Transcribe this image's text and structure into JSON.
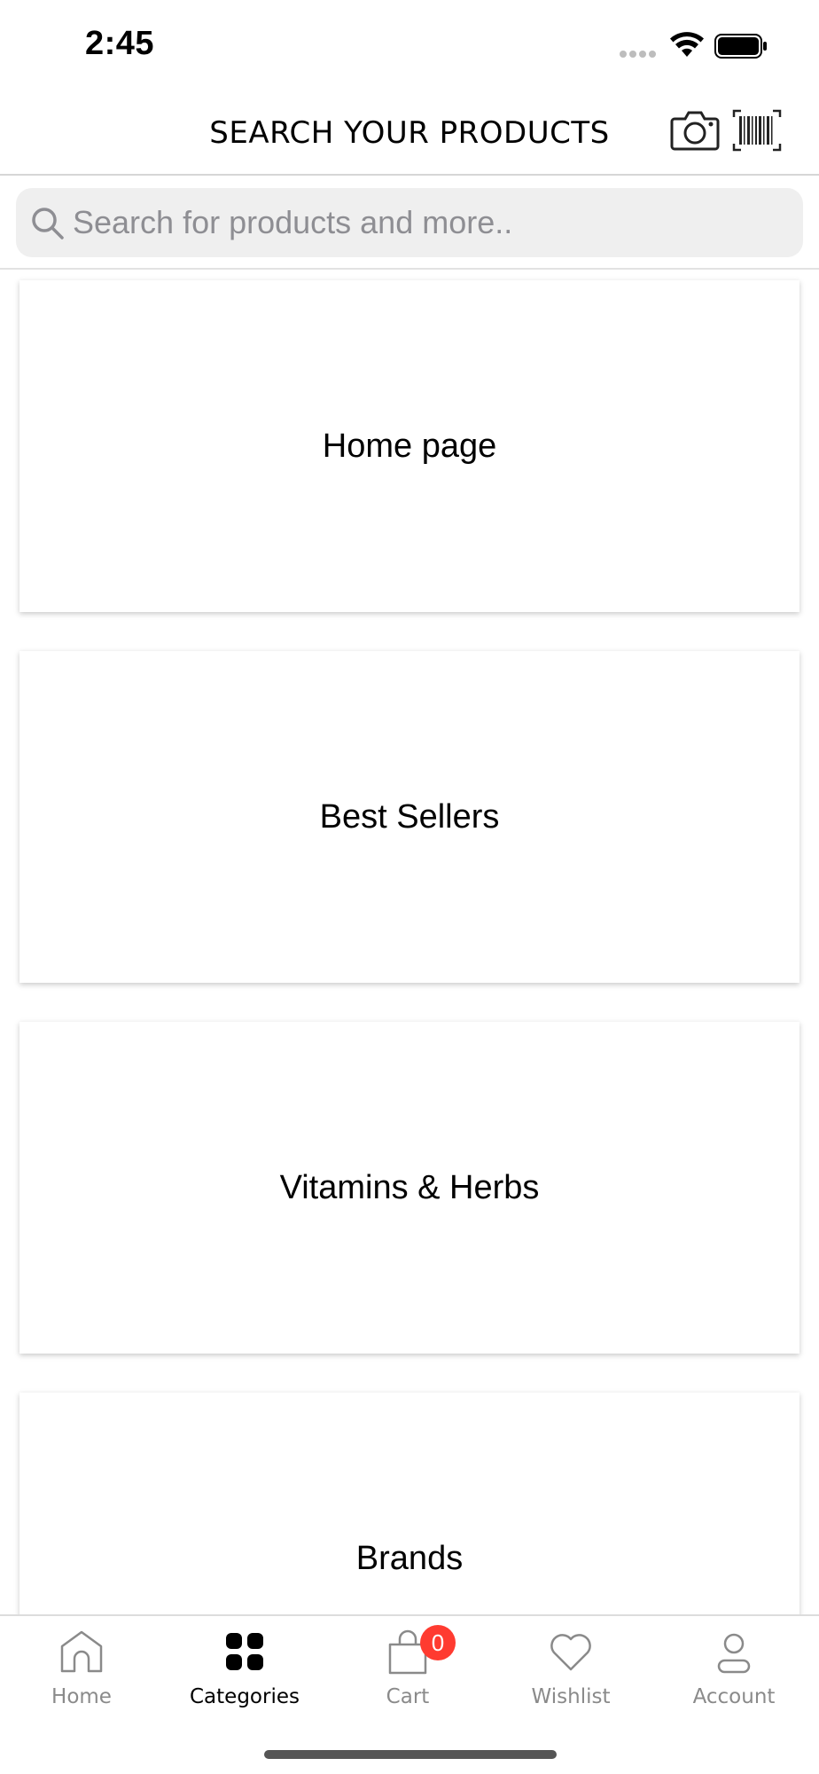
{
  "status_bar": {
    "time": "2:45"
  },
  "header": {
    "title": "SEARCH YOUR PRODUCTS"
  },
  "search": {
    "placeholder": "Search for products and more.."
  },
  "categories": [
    {
      "label": "Home page"
    },
    {
      "label": "Best Sellers"
    },
    {
      "label": "Vitamins & Herbs"
    },
    {
      "label": "Brands"
    }
  ],
  "tab_bar": {
    "active": "Categories",
    "items": [
      {
        "label": "Home",
        "icon": "home-icon"
      },
      {
        "label": "Categories",
        "icon": "grid-icon"
      },
      {
        "label": "Cart",
        "icon": "shopping-bag-icon",
        "badge": "0"
      },
      {
        "label": "Wishlist",
        "icon": "heart-icon"
      },
      {
        "label": "Account",
        "icon": "user-icon"
      }
    ]
  },
  "colors": {
    "badge": "#ff3b30",
    "inactive_tab": "#8a8a8a",
    "search_bg": "#efefef"
  }
}
